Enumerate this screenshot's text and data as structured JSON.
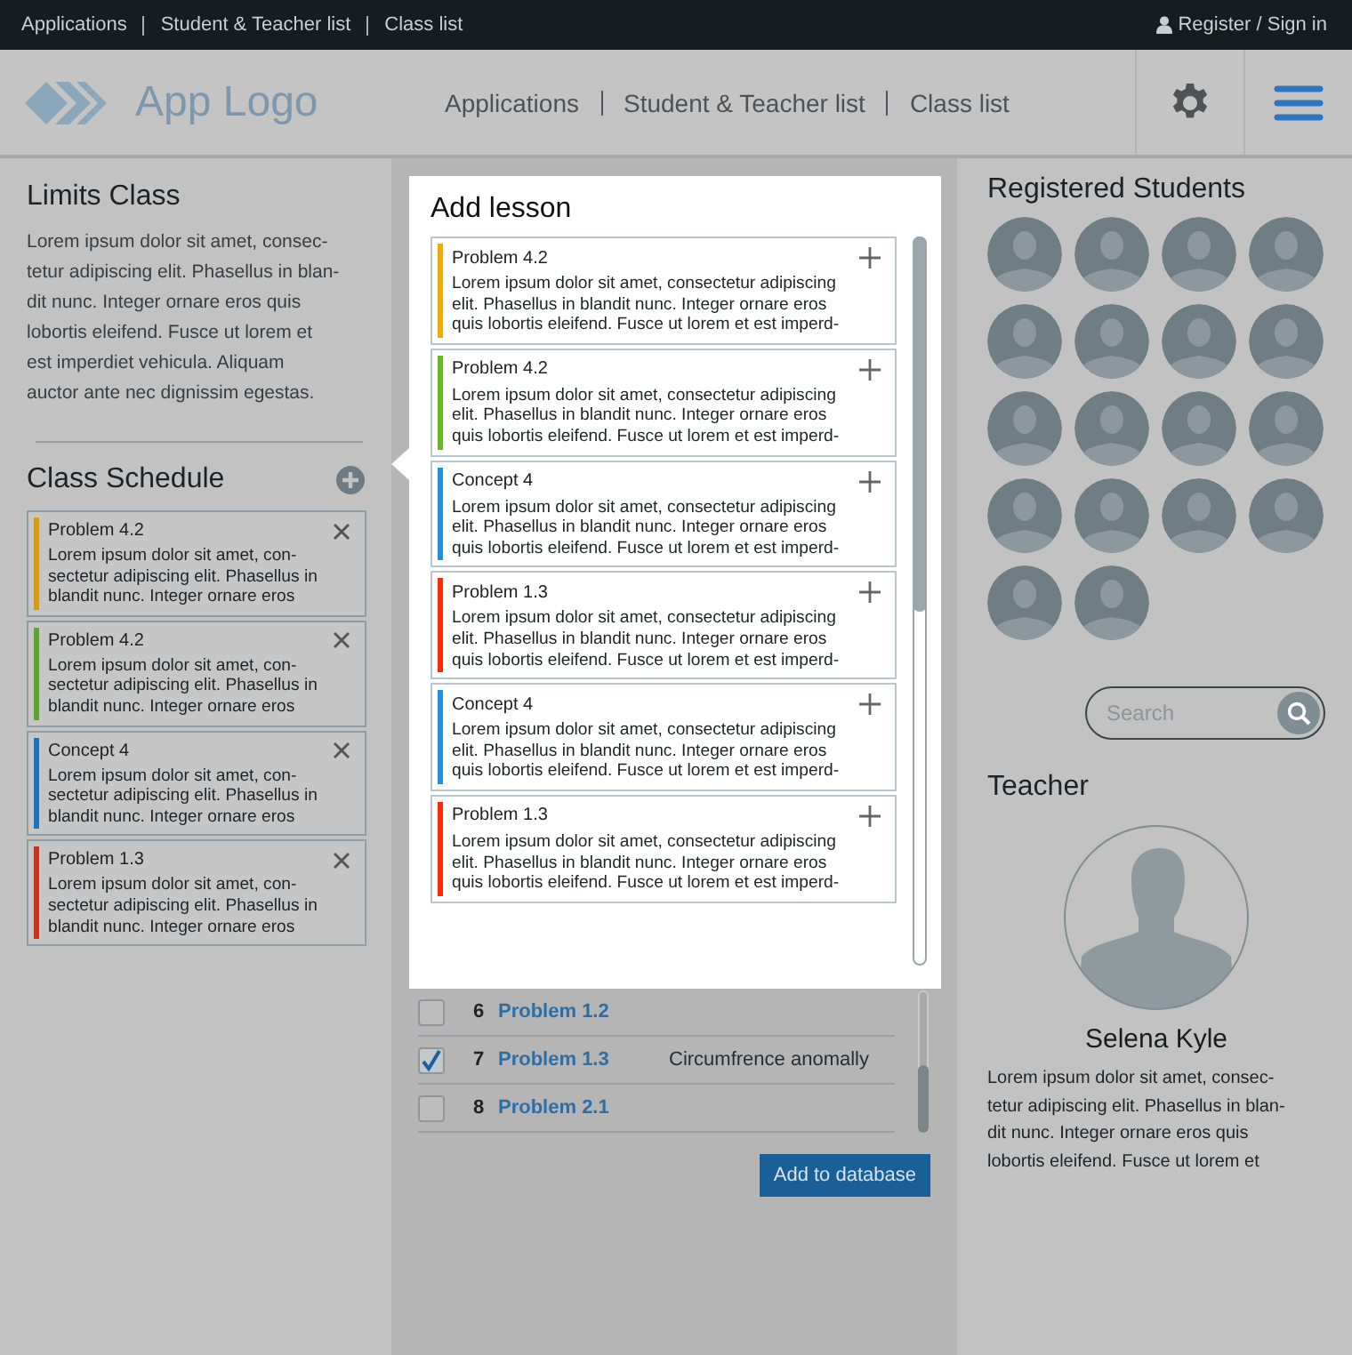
{
  "top_bar": {
    "links": [
      "Applications",
      "Student & Teacher list",
      "Class list"
    ],
    "account": "Register / Sign in"
  },
  "header": {
    "logo": "App Logo",
    "nav": [
      "Applications",
      "Student & Teacher list",
      "Class list"
    ]
  },
  "class_info": {
    "title": "Limits Class",
    "description": "Lorem ipsum dolor sit amet, consec-\ntetur adipiscing elit. Phasellus in blan-\ndit nunc. Integer ornare eros quis\nlobortis eleifend. Fusce ut lorem et\nest imperdiet vehicula. Aliquam\nauctor ante nec dignissim egestas."
  },
  "schedule": {
    "title": "Class Schedule",
    "items": [
      {
        "title": "Problem 4.2",
        "color": "#d99a0e",
        "text": "Lorem ipsum dolor sit amet, con-\nsectetur adipiscing elit. Phasellus in\nblandit nunc. Integer ornare eros"
      },
      {
        "title": "Problem 4.2",
        "color": "#5ea52c",
        "text": "Lorem ipsum dolor sit amet, con-\nsectetur adipiscing elit. Phasellus in\nblandit nunc. Integer ornare eros"
      },
      {
        "title": "Concept 4",
        "color": "#1a73b8",
        "text": "Lorem ipsum dolor sit amet, con-\nsectetur adipiscing elit. Phasellus in\nblandit nunc. Integer ornare eros"
      },
      {
        "title": "Problem 1.3",
        "color": "#c8321a",
        "text": "Lorem ipsum dolor sit amet, con-\nsectetur adipiscing elit. Phasellus in\nblandit nunc. Integer ornare eros"
      }
    ]
  },
  "add_lesson": {
    "title": "Add lesson",
    "items": [
      {
        "title": "Problem 4.2",
        "color": "#f5a800",
        "text": "Lorem ipsum dolor sit amet, consectetur adipiscing\nelit. Phasellus in blandit nunc. Integer ornare eros\nquis lobortis eleifend. Fusce ut lorem et est imperd-"
      },
      {
        "title": "Problem 4.2",
        "color": "#66bb22",
        "text": "Lorem ipsum dolor sit amet, consectetur adipiscing\nelit. Phasellus in blandit nunc. Integer ornare eros\nquis lobortis eleifend. Fusce ut lorem et est imperd-"
      },
      {
        "title": "Concept 4",
        "color": "#1e90e6",
        "text": "Lorem ipsum dolor sit amet, consectetur adipiscing\nelit. Phasellus in blandit nunc. Integer ornare eros\nquis lobortis eleifend. Fusce ut lorem et est imperd-"
      },
      {
        "title": "Problem 1.3",
        "color": "#ff2a00",
        "text": "Lorem ipsum dolor sit amet, consectetur adipiscing\nelit. Phasellus in blandit nunc. Integer ornare eros\nquis lobortis eleifend. Fusce ut lorem et est imperd-"
      },
      {
        "title": "Concept 4",
        "color": "#1e90e6",
        "text": "Lorem ipsum dolor sit amet, consectetur adipiscing\nelit. Phasellus in blandit nunc. Integer ornare eros\nquis lobortis eleifend. Fusce ut lorem et est imperd-"
      },
      {
        "title": "Problem 1.3",
        "color": "#ff2a00",
        "text": "Lorem ipsum dolor sit amet, consectetur adipiscing\nelit. Phasellus in blandit nunc. Integer ornare eros\nquis lobortis eleifend. Fusce ut lorem et est imperd-"
      }
    ]
  },
  "lessons_table": {
    "rows": [
      {
        "number": "6",
        "title": "Problem 1.2",
        "checked": false
      },
      {
        "number": "7",
        "title": "Problem 1.3",
        "note": "Circumfrence anomally",
        "checked": true
      },
      {
        "number": "8",
        "title": "Problem 2.1",
        "checked": false
      }
    ],
    "button": "Add to database"
  },
  "students": {
    "title": "Registered Students",
    "search": {
      "placeholder": "Search"
    }
  },
  "teacher": {
    "title": "Teacher",
    "name": "Selena Kyle",
    "bio": "Lorem ipsum dolor sit amet, consec-\ntetur adipiscing elit. Phasellus in blan-\ndit nunc. Integer ornare eros quis\nlobortis eleifend. Fusce ut lorem et"
  }
}
